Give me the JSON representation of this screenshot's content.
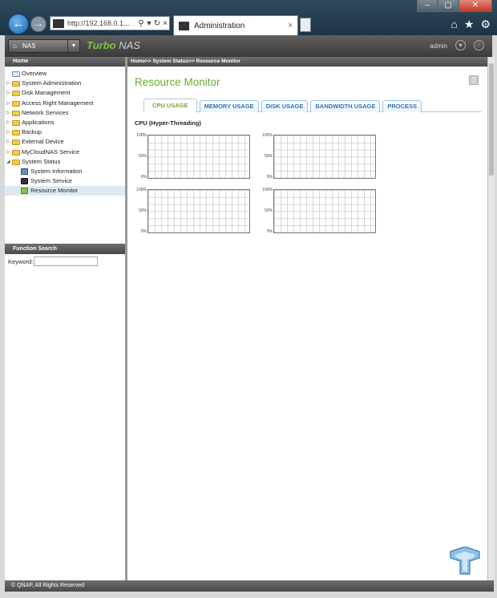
{
  "browser": {
    "url": "http://192.168.0.1...",
    "tab_title": "Administration",
    "window_controls": [
      "–",
      "▢",
      "✕"
    ]
  },
  "header": {
    "nas_button": "NAS",
    "brand_turbo": "Turbo",
    "brand_nas": " NAS",
    "user": "admin"
  },
  "sidebar": {
    "title": "Home",
    "items": [
      {
        "label": "Overview"
      },
      {
        "label": "System Administration"
      },
      {
        "label": "Disk Management"
      },
      {
        "label": "Access Right Management"
      },
      {
        "label": "Network Services"
      },
      {
        "label": "Applications"
      },
      {
        "label": "Backup"
      },
      {
        "label": "External Device"
      },
      {
        "label": "MyCloudNAS Service"
      },
      {
        "label": "System Status"
      }
    ],
    "children": [
      {
        "label": "System Information"
      },
      {
        "label": "System Service"
      },
      {
        "label": "Resource Monitor"
      }
    ]
  },
  "function_search": {
    "title": "Function Search",
    "keyword_label": "Keyword:",
    "keyword_value": ""
  },
  "main": {
    "breadcrumb": "Home>> System Status>> Resource Monitor",
    "title": "Resource Monitor",
    "tabs": [
      {
        "label": "CPU USAGE"
      },
      {
        "label": "MEMORY USAGE"
      },
      {
        "label": "DISK USAGE"
      },
      {
        "label": "BANDWIDTH USAGE"
      },
      {
        "label": "PROCESS"
      }
    ],
    "active_tab": "CPU USAGE",
    "cpu_label": "CPU (Hyper-Threading)",
    "y_ticks": [
      "100%",
      "50%",
      "0%"
    ]
  },
  "footer": {
    "copyright": "© QNAP, All Rights Reserved"
  },
  "colors": {
    "accent_green": "#6aab2d",
    "tab_blue": "#2a77c0"
  }
}
